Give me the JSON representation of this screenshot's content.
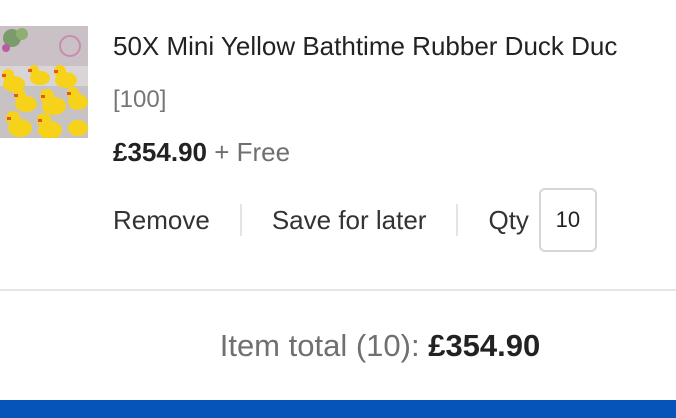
{
  "item": {
    "title": "50X Mini Yellow Bathtime Rubber Duck Duc",
    "variant": "[100]",
    "price": "£354.90",
    "shipping": "+ Free",
    "image_icon": "rubber-duck-product-image"
  },
  "actions": {
    "remove_label": "Remove",
    "save_label": "Save for later",
    "qty_label": "Qty",
    "qty_value": "10"
  },
  "summary": {
    "total_label": "Item total (10):",
    "total_value": "£354.90"
  },
  "colors": {
    "accent_bar": "#0654ba",
    "duck_yellow": "#f7d21a"
  }
}
